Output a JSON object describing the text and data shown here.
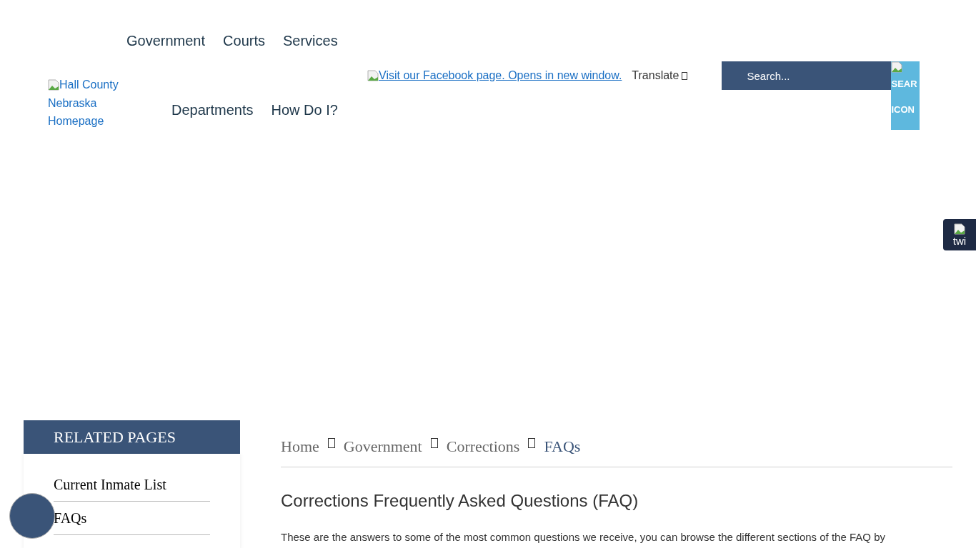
{
  "top_nav": [
    "Government",
    "Courts",
    "Services"
  ],
  "logo": {
    "alt": "Hall County Nebraska Homepage"
  },
  "main_nav": [
    "Departments",
    "How Do I?"
  ],
  "facebook_link": "Visit our Facebook page. Opens in new window.",
  "translate": "Translate",
  "search": {
    "placeholder": "Search...",
    "button_lines": [
      "SEAR",
      "ICON"
    ]
  },
  "side_tab": "twi",
  "sidebar": {
    "title": "RELATED PAGES",
    "items": [
      "Current Inmate List",
      "FAQs"
    ]
  },
  "breadcrumb": [
    {
      "label": "Home",
      "current": false
    },
    {
      "label": "Government",
      "current": false
    },
    {
      "label": "Corrections",
      "current": false
    },
    {
      "label": "FAQs",
      "current": true
    }
  ],
  "heading": "Corrections Frequently Asked Questions (FAQ)",
  "intro": "These are the answers to some of the most common questions we receive, you can browse the different sections of the FAQ by"
}
